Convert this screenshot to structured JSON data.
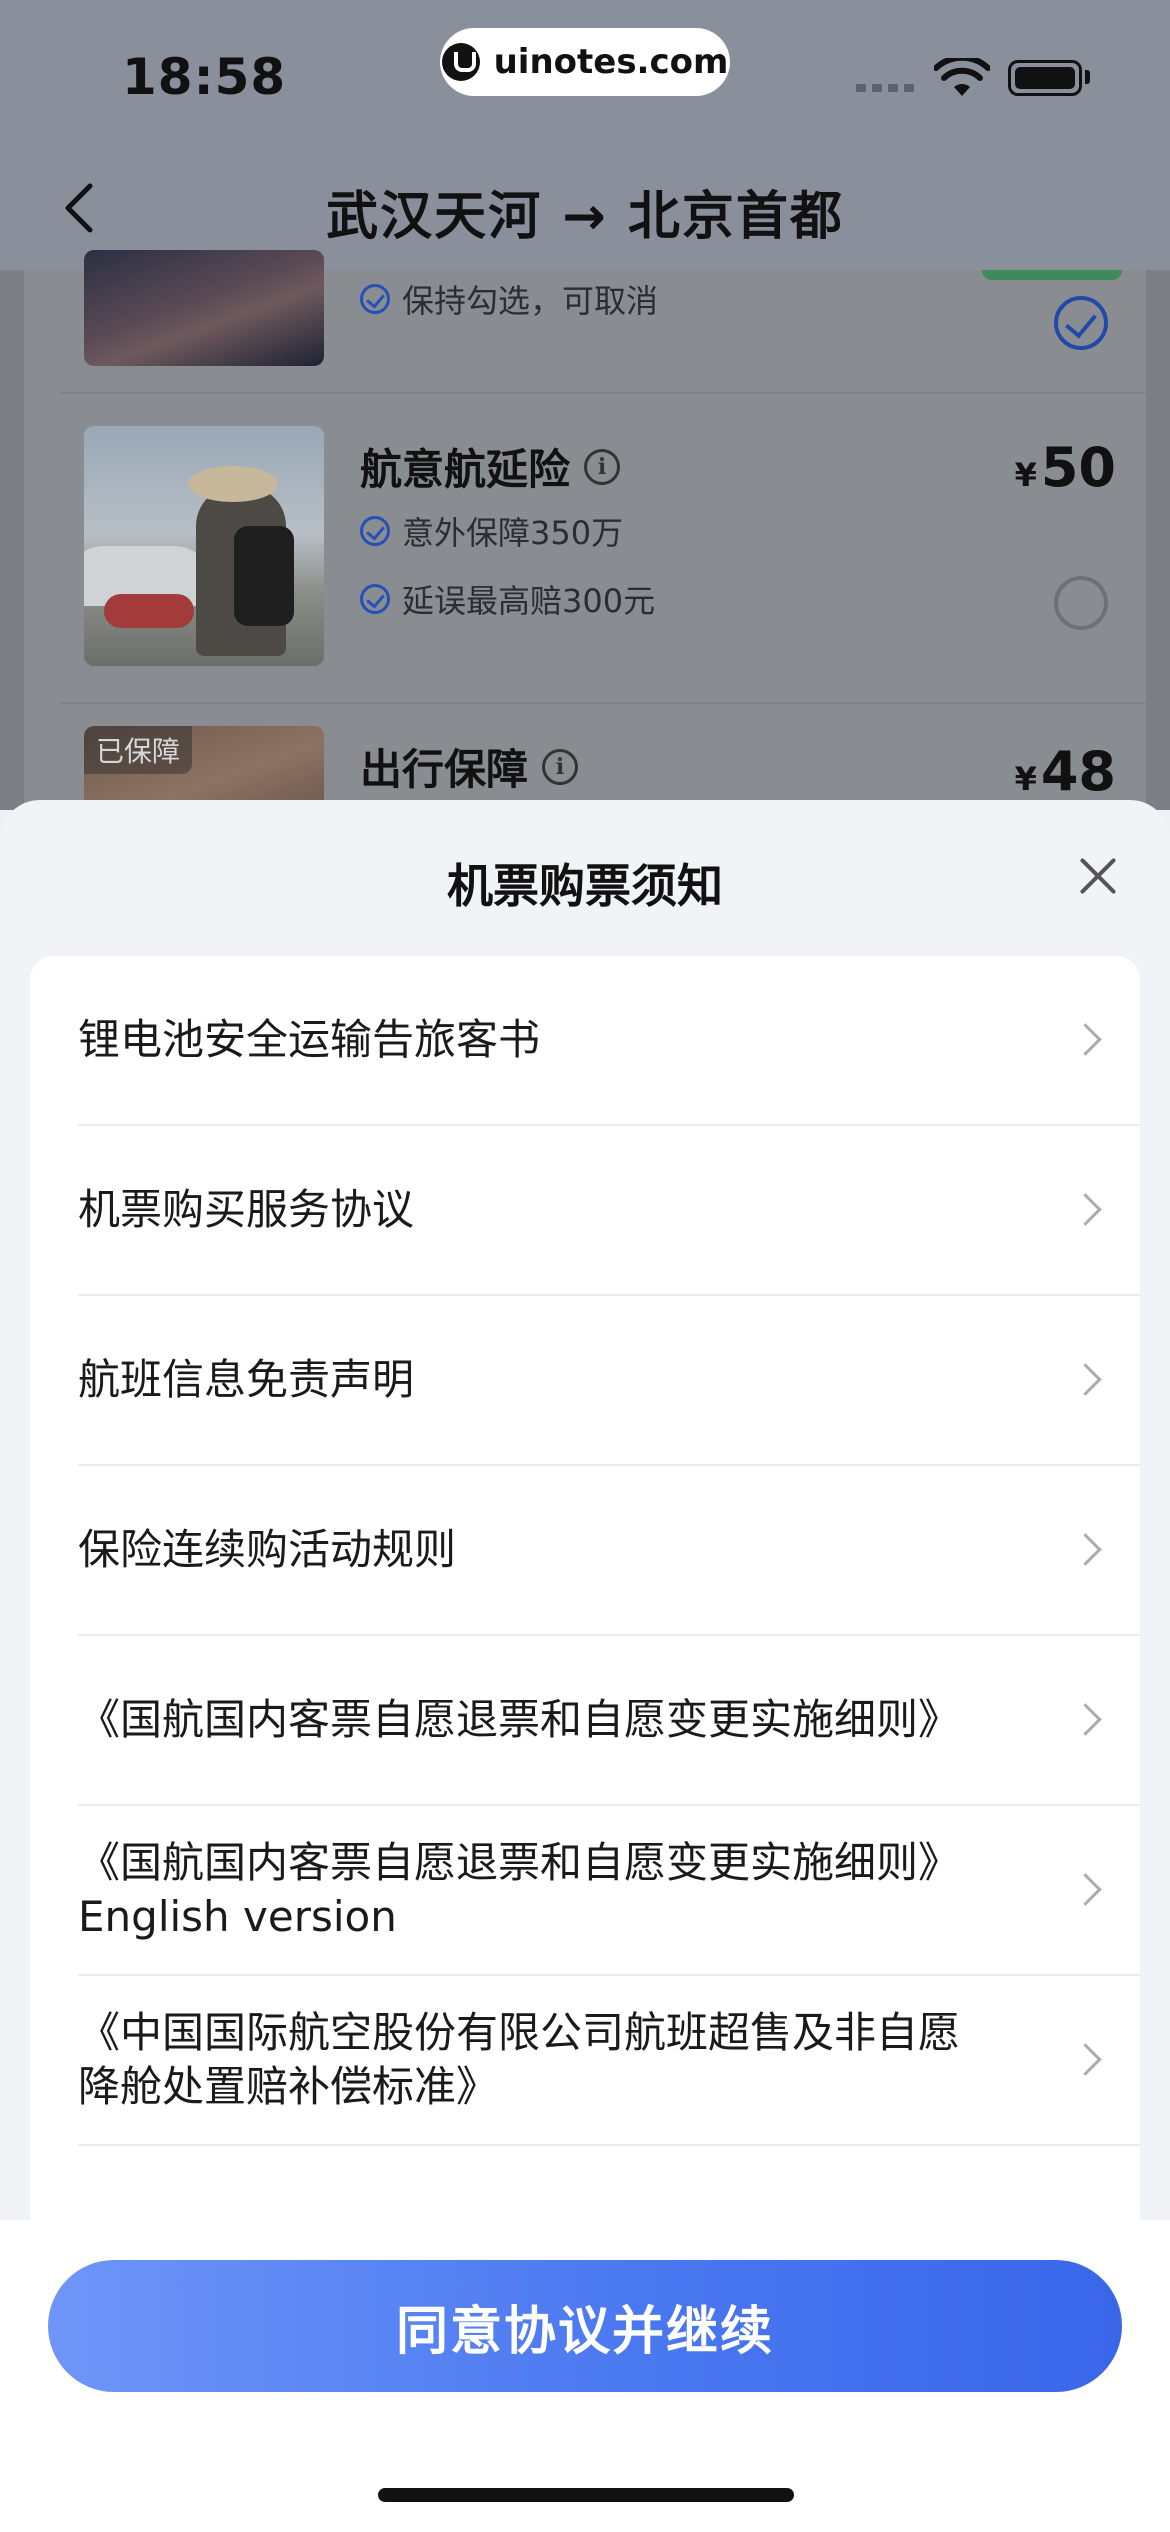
{
  "status_bar": {
    "time": "18:58",
    "watermark": "uinotes.com",
    "icons": [
      "signal-icon",
      "wifi-icon",
      "battery-icon"
    ]
  },
  "nav": {
    "back_icon": "chevron-left-icon",
    "title": "武汉天河 → 北京首都"
  },
  "background_page": {
    "insurance_items": [
      {
        "title": "",
        "features": [
          "保持勾选，可取消"
        ],
        "price_symbol": "",
        "price": "",
        "selected": true
      },
      {
        "title": "航意航延险",
        "features": [
          "意外保障350万",
          "延误最高赔300元"
        ],
        "price_symbol": "¥",
        "price": "50",
        "selected": false
      },
      {
        "title": "出行保障",
        "tag": "已保障",
        "features": [],
        "price_symbol": "¥",
        "price": "48",
        "selected": false
      }
    ]
  },
  "sheet": {
    "title": "机票购票须知",
    "close_icon": "close-icon",
    "items": [
      {
        "label": "锂电池安全运输告旅客书"
      },
      {
        "label": "机票购买服务协议"
      },
      {
        "label": "航班信息免责声明"
      },
      {
        "label": "保险连续购活动规则"
      },
      {
        "label": "《国航国内客票自愿退票和自愿变更实施细则》"
      },
      {
        "label": "《国航国内客票自愿退票和自愿变更实施细则》English version"
      },
      {
        "label": "《中国国际航空股份有限公司航班超售及非自愿降舱处置赔补偿标准》"
      }
    ],
    "agree_button": "同意协议并继续"
  },
  "colors": {
    "primary": "#4a78f0",
    "primary_light": "#6f95f8",
    "check_blue": "#1f4aa8",
    "sheet_bg": "#f2f3f6"
  }
}
